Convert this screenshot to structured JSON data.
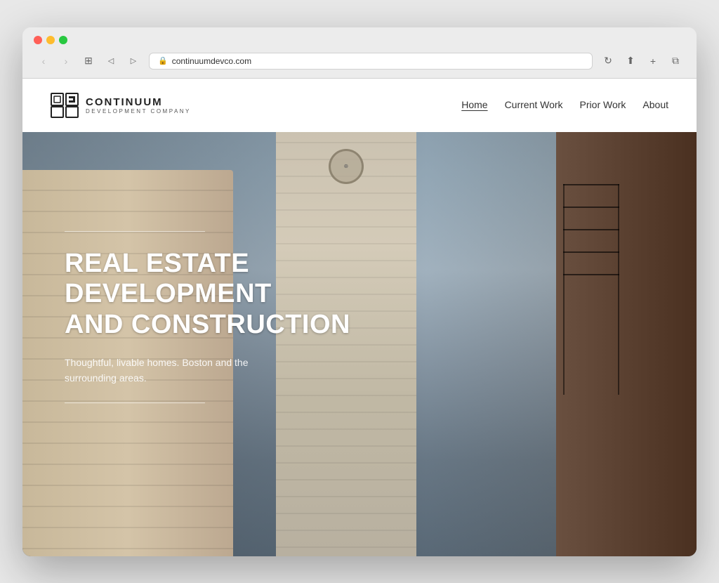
{
  "browser": {
    "url": "continuumdevco.com",
    "url_icon": "🔒",
    "back_btn": "‹",
    "forward_btn": "›",
    "window_control_btn": "⊞",
    "refresh_btn": "↻",
    "share_btn": "⬆",
    "new_tab_btn": "+",
    "copy_btn": "⧉"
  },
  "nav": {
    "logo_name": "CONTINUUM",
    "logo_subtitle": "DEVELOPMENT COMPANY",
    "menu_items": [
      {
        "label": "Home",
        "active": true
      },
      {
        "label": "Current Work",
        "active": false
      },
      {
        "label": "Prior Work",
        "active": false
      },
      {
        "label": "About",
        "active": false
      }
    ]
  },
  "hero": {
    "title_line1": "REAL ESTATE",
    "title_line2": "DEVELOPMENT",
    "title_line3": "AND CONSTRUCTION",
    "subtitle": "Thoughtful, livable homes. Boston and the surrounding areas."
  }
}
